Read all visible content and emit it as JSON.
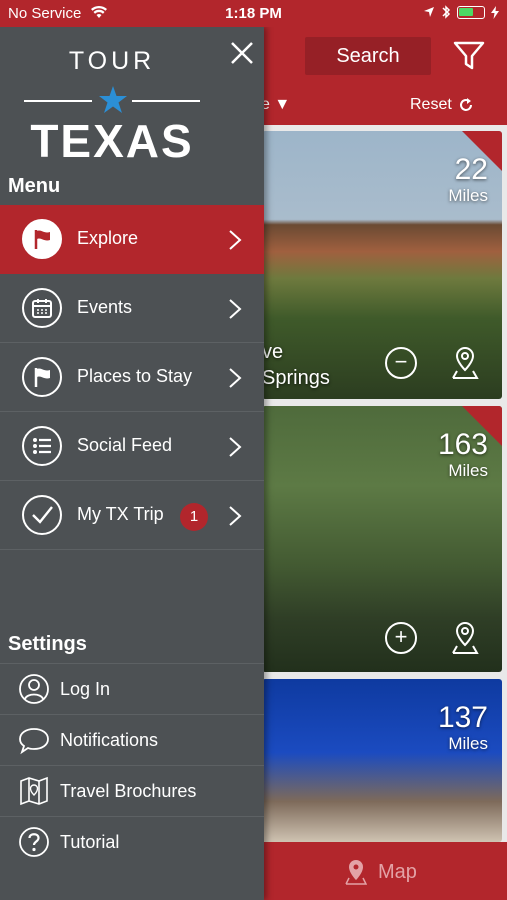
{
  "status_bar": {
    "carrier": "No Service",
    "time": "1:18 PM"
  },
  "header": {
    "search_label": "Search",
    "sort_label": "ce",
    "reset_label": "Reset"
  },
  "cards": [
    {
      "distance": "22",
      "unit": "Miles",
      "title_line1": "ve",
      "title_line2": "Springs",
      "action": "remove"
    },
    {
      "distance": "163",
      "unit": "Miles",
      "action": "add"
    },
    {
      "distance": "137",
      "unit": "Miles"
    }
  ],
  "map_bar": {
    "label": "Map"
  },
  "drawer": {
    "logo_top": "TOUR",
    "logo_bottom": "TEXAS",
    "menu_title": "Menu",
    "menu_items": [
      {
        "label": "Explore",
        "icon": "flag-icon",
        "active": true
      },
      {
        "label": "Events",
        "icon": "calendar-icon"
      },
      {
        "label": "Places to Stay",
        "icon": "flag-icon"
      },
      {
        "label": "Social Feed",
        "icon": "list-icon"
      },
      {
        "label": "My TX Trip",
        "icon": "check-icon",
        "badge": "1"
      }
    ],
    "settings_title": "Settings",
    "settings_items": [
      {
        "label": "Log In",
        "icon": "user-icon"
      },
      {
        "label": "Notifications",
        "icon": "chat-bubble-icon"
      },
      {
        "label": "Travel Brochures",
        "icon": "map-brochure-icon"
      },
      {
        "label": "Tutorial",
        "icon": "help-icon"
      }
    ]
  },
  "colors": {
    "brand_red": "#b2262c",
    "drawer_bg": "#4d5154",
    "accent_blue": "#2b8fd6"
  }
}
